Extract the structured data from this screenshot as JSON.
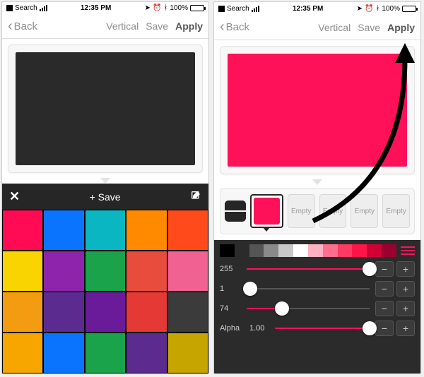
{
  "status": {
    "search": "Search",
    "time": "12:35 PM",
    "battery_pct": "100%"
  },
  "nav": {
    "back": "Back",
    "vertical": "Vertical",
    "save": "Save",
    "apply": "Apply"
  },
  "left": {
    "preview_color": "#2a2a2a",
    "palette_header": {
      "save": "+ Save"
    },
    "swatches": [
      "#ff0b55",
      "#0b74ff",
      "#09b6c1",
      "#ff8a00",
      "#ff4a1c",
      "#f9d400",
      "#8e24aa",
      "#1aa34a",
      "#e74c3c",
      "#f06292",
      "#f39c12",
      "#5c2b90",
      "#6a1b9a",
      "#e53935",
      "#3b3b3b",
      "#f7a600",
      "#0b74ff",
      "#1aa34a",
      "#5c2b90",
      "#c7a500"
    ]
  },
  "right": {
    "preview_color": "#ff1159",
    "slots": {
      "active_color": "#ff1159",
      "empty_label": "Empty"
    },
    "gradient_stops": [
      "#000000",
      "#2b2b2b",
      "#555555",
      "#8a8a8a",
      "#c8c8c8",
      "#ffffff",
      "#ffb0c3",
      "#ff6f8d",
      "#ff3a63",
      "#ff1547",
      "#d10034",
      "#9c0030"
    ],
    "sliders": {
      "r": {
        "label": "255",
        "pct": 100
      },
      "g": {
        "label": "1",
        "pct": 3
      },
      "b": {
        "label": "74",
        "pct": 29
      },
      "alpha_label": "Alpha",
      "alpha_value": "1.00",
      "alpha_pct": 100
    }
  }
}
